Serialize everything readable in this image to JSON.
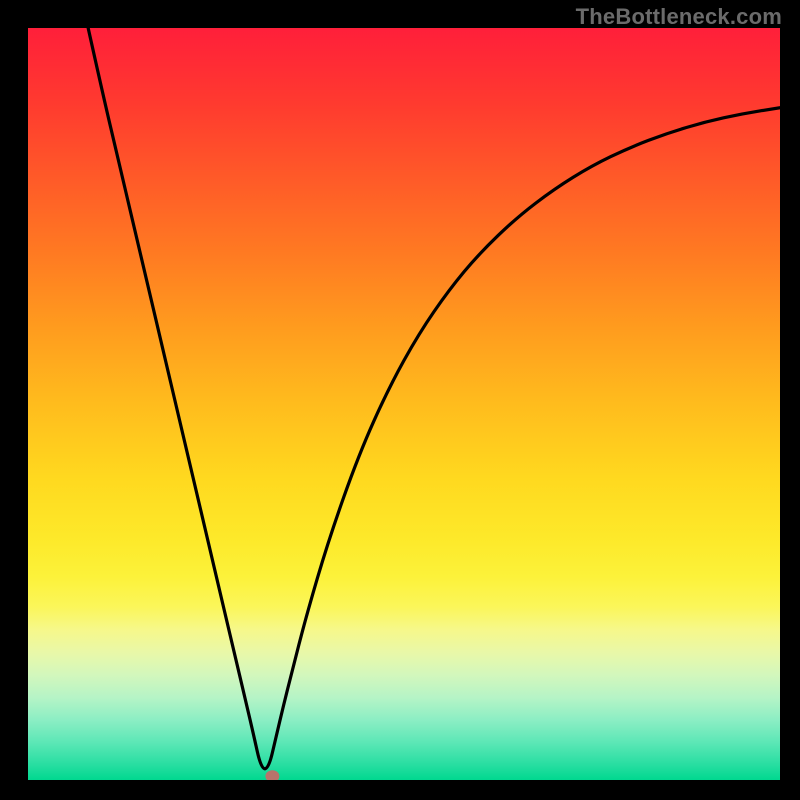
{
  "watermark": "TheBottleneck.com",
  "colors": {
    "top_red": "#ff1f3a",
    "mid_orange": "#ff8f20",
    "mid_yellow": "#fbe62c",
    "pale_yellow": "#fbf98f",
    "bottom_green": "#00d88f",
    "curve_stroke": "#000000",
    "marker_fill": "#b9736b",
    "watermark_text": "#6b6b6b",
    "frame_black": "#000000"
  },
  "chart_data": {
    "type": "line",
    "title": "",
    "xlabel": "",
    "ylabel": "",
    "xlim": [
      0,
      100
    ],
    "ylim": [
      0,
      100
    ],
    "legend_position": "none",
    "grid": false,
    "annotations": [
      "TheBottleneck.com"
    ],
    "minimum_at_x": 31,
    "marker": {
      "x": 32.5,
      "y": 0.5
    },
    "series": [
      {
        "name": "bottleneck-curve",
        "x": [
          8,
          10,
          12,
          14,
          16,
          18,
          20,
          22,
          24,
          26,
          28,
          29,
          30,
          31,
          32,
          33,
          34,
          35,
          37,
          40,
          44,
          48,
          52,
          56,
          60,
          65,
          70,
          75,
          80,
          85,
          90,
          95,
          100
        ],
        "y": [
          100,
          91,
          82.5,
          74,
          65.5,
          57,
          48.5,
          40,
          31.5,
          23,
          14.5,
          10.3,
          6,
          1.5,
          1.5,
          5.8,
          10,
          14,
          21.8,
          32,
          43.3,
          52.2,
          59.4,
          65.2,
          70,
          74.8,
          78.6,
          81.7,
          84.1,
          86,
          87.5,
          88.6,
          89.4
        ]
      }
    ]
  }
}
